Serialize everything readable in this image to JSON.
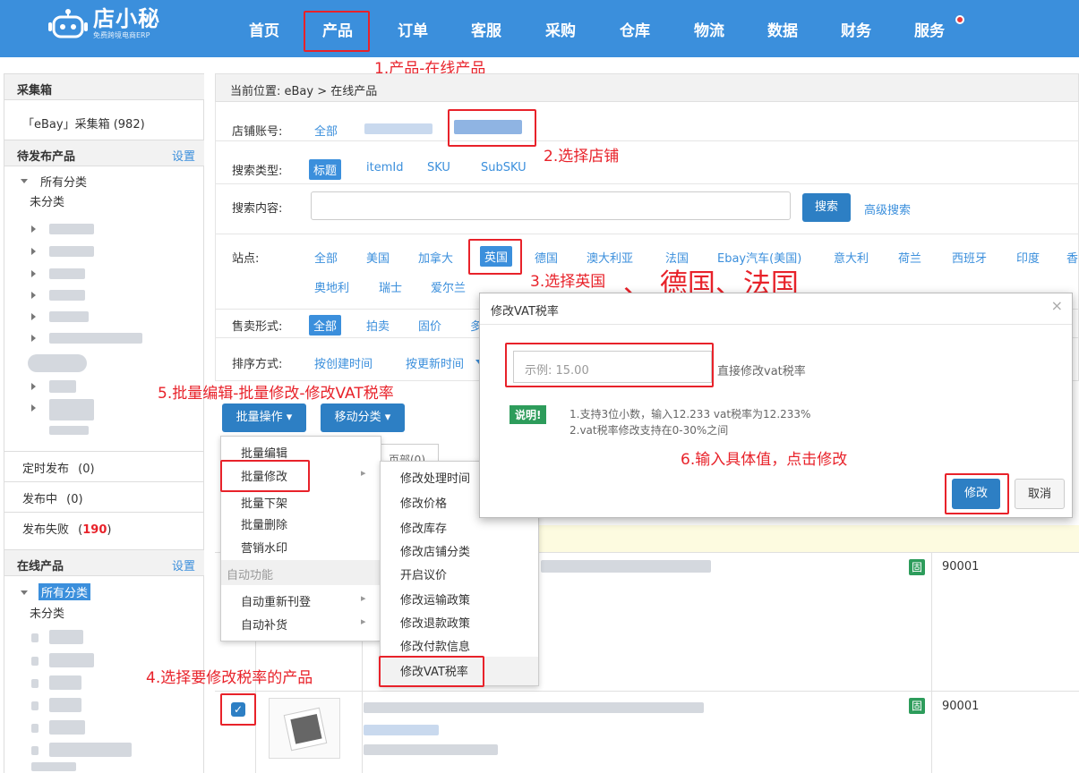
{
  "app": {
    "brand": "店小秘",
    "brand_sub": "免费跨境电商ERP"
  },
  "nav": [
    "首页",
    "产品",
    "订单",
    "客服",
    "采购",
    "仓库",
    "物流",
    "数据",
    "财务",
    "服务"
  ],
  "sidebar": {
    "collect_box": "采集箱",
    "ebay_box": "「eBay」采集箱 (982)",
    "pending": "待发布产品",
    "settings": "设置",
    "all_categories": "所有分类",
    "uncategorized": "未分类",
    "scheduled": "定时发布",
    "scheduled_count": "(0)",
    "publishing": "发布中",
    "publishing_count": "(0)",
    "failed": "发布失败",
    "failed_count_open": "(",
    "failed_count": "190",
    "failed_count_close": ")",
    "online": "在线产品",
    "online_settings": "设置",
    "online_all": "所有分类",
    "online_uncat": "未分类"
  },
  "breadcrumb": "当前位置:  eBay > 在线产品",
  "filters": {
    "shop_label": "店铺账号:",
    "shop_all": "全部",
    "search_type_label": "搜索类型:",
    "search_types": [
      "标题",
      "itemId",
      "SKU",
      "SubSKU"
    ],
    "search_content_label": "搜索内容:",
    "search_button": "搜索",
    "advanced": "高级搜索",
    "site_label": "站点:",
    "sites_row1": [
      "全部",
      "美国",
      "加拿大",
      "英国",
      "德国",
      "澳大利亚",
      "法国",
      "Ebay汽车(美国)",
      "意大利",
      "荷兰",
      "西班牙",
      "印度",
      "香"
    ],
    "sites_row2": [
      "奥地利",
      "瑞士",
      "爱尔兰"
    ],
    "sale_label": "售卖形式:",
    "sale_types": [
      "全部",
      "拍卖",
      "固价",
      "多"
    ],
    "sort_label": "排序方式:",
    "sort_create": "按创建时间",
    "sort_update": "按更新时间"
  },
  "actions": {
    "bulk": "批量操作 ▾",
    "move": "移动分类 ▾"
  },
  "dropdown": {
    "items": [
      "批量编辑",
      "批量修改",
      "批量下架",
      "批量删除",
      "营销水印"
    ],
    "auto_header": "自动功能",
    "auto_items": [
      "自动重新刊登",
      "自动补货"
    ]
  },
  "submenu": [
    "修改处理时间",
    "修改价格",
    "修改库存",
    "修改店铺分类",
    "开启议价",
    "修改运输政策",
    "修改退款政策",
    "修改付款信息",
    "修改VAT税率"
  ],
  "modal": {
    "title": "修改VAT税率",
    "placeholder": "示例: 15.00",
    "hint": "直接修改vat税率",
    "note_label": "说明!",
    "note1": "1.支持3位小数，输入12.233 vat税率为12.233%",
    "note2": "2.vat税率修改支持在0-30%之间",
    "confirm": "修改",
    "cancel": "取消",
    "close": "×"
  },
  "rows": [
    {
      "badge": "固",
      "code": "90001"
    },
    {
      "badge": "固",
      "code": "90001"
    }
  ],
  "annotations": {
    "a1": "1.产品-在线产品",
    "a2": "2.选择店铺",
    "a3": "3.选择英国",
    "a3b": "、 德国、法国",
    "a4": "4.选择要修改税率的产品",
    "a5": "5.批量编辑-批量修改-修改VAT税率",
    "a6": "6.输入具体值，点击修改"
  },
  "misc": {
    "page_tab": "页部(0)",
    "checkbox_mark": "✓"
  }
}
